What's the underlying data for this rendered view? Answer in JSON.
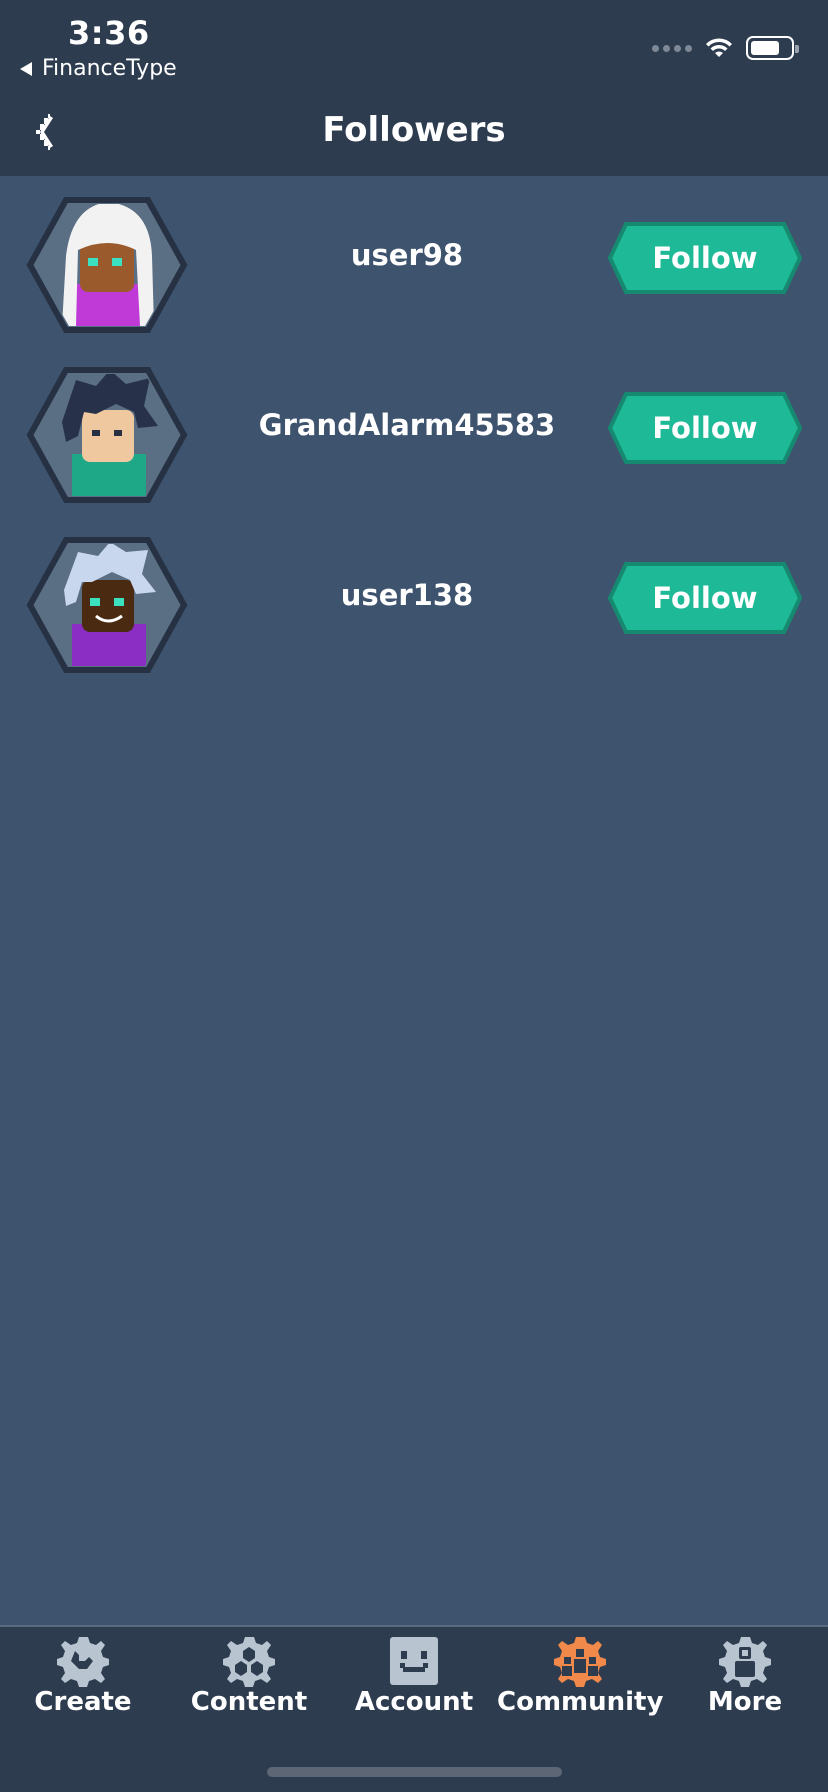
{
  "status_bar": {
    "time": "3:36",
    "back_app": "FinanceType"
  },
  "header": {
    "title": "Followers",
    "back_icon": "chevron-left-icon"
  },
  "followers": [
    {
      "username": "user98",
      "follow_label": "Follow",
      "avatar_shirt_color": "#c03ad8",
      "avatar_hair_color": "#f2f2f2",
      "avatar_skin_color": "#9a5a2c"
    },
    {
      "username": "GrandAlarm45583",
      "follow_label": "Follow",
      "avatar_shirt_color": "#1fa888",
      "avatar_hair_color": "#27324a",
      "avatar_skin_color": "#f0c8a0"
    },
    {
      "username": "user138",
      "follow_label": "Follow",
      "avatar_shirt_color": "#8a2ec4",
      "avatar_hair_color": "#c8d6ee",
      "avatar_skin_color": "#4a2a10"
    }
  ],
  "tabs": [
    {
      "label": "Create",
      "icon": "wrench-gear-icon",
      "active": false
    },
    {
      "label": "Content",
      "icon": "hexagon-cluster-icon",
      "active": false
    },
    {
      "label": "Account",
      "icon": "smiley-face-icon",
      "active": false
    },
    {
      "label": "Community",
      "icon": "people-gear-icon",
      "active": true
    },
    {
      "label": "More",
      "icon": "person-gear-icon",
      "active": false
    }
  ],
  "colors": {
    "background": "#3e536e",
    "bar": "#2e3c50",
    "follow_button": "#1eb996",
    "follow_button_border": "#168a70",
    "tab_icon": "#b8c4d0",
    "tab_icon_active": "#f0894a"
  }
}
